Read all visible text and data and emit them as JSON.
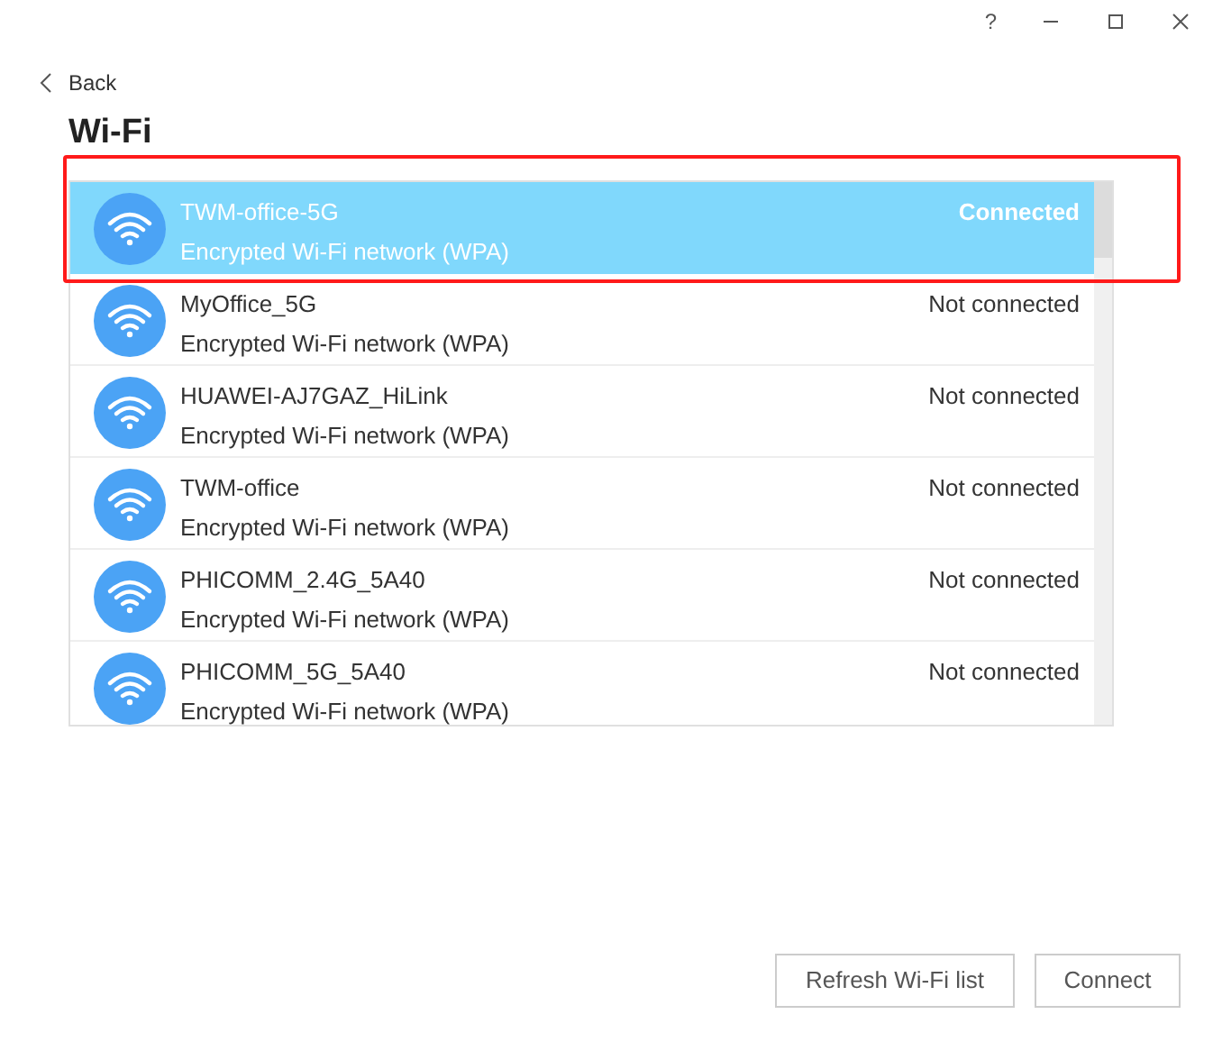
{
  "window": {
    "controls": [
      "?"
    ]
  },
  "back": {
    "label": "Back"
  },
  "title": "Wi-Fi",
  "networks": [
    {
      "name": "TWM-office-5G",
      "description": "Encrypted Wi-Fi network (WPA)",
      "status": "Connected",
      "selected": true
    },
    {
      "name": "MyOffice_5G",
      "description": "Encrypted Wi-Fi network (WPA)",
      "status": "Not connected",
      "selected": false
    },
    {
      "name": "HUAWEI-AJ7GAZ_HiLink",
      "description": "Encrypted Wi-Fi network (WPA)",
      "status": "Not connected",
      "selected": false
    },
    {
      "name": "TWM-office",
      "description": "Encrypted Wi-Fi network (WPA)",
      "status": "Not connected",
      "selected": false
    },
    {
      "name": "PHICOMM_2.4G_5A40",
      "description": "Encrypted Wi-Fi network (WPA)",
      "status": "Not connected",
      "selected": false
    },
    {
      "name": "PHICOMM_5G_5A40",
      "description": "Encrypted Wi-Fi network (WPA)",
      "status": "Not connected",
      "selected": false
    }
  ],
  "buttons": [
    "Refresh Wi-Fi list",
    "Connect"
  ]
}
